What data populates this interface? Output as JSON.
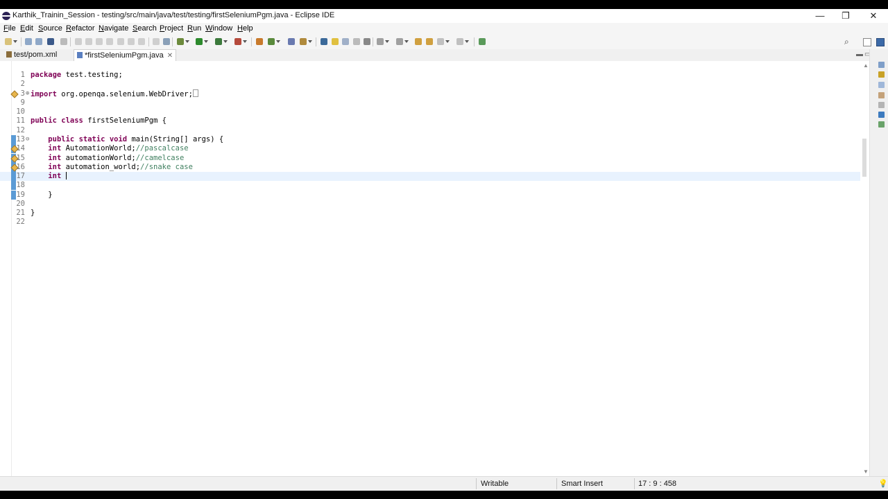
{
  "window": {
    "title": "Karthik_Trainin_Session - testing/src/main/java/test/testing/firstSeleniumPgm.java - Eclipse IDE",
    "controls": {
      "minimize": "—",
      "restore": "❐",
      "close": "✕"
    }
  },
  "menu": [
    "File",
    "Edit",
    "Source",
    "Refactor",
    "Navigate",
    "Search",
    "Project",
    "Run",
    "Window",
    "Help"
  ],
  "tabs": [
    {
      "label": "test/pom.xml",
      "active": false
    },
    {
      "label": "*firstSeleniumPgm.java",
      "active": true,
      "close": "✕"
    }
  ],
  "tab_controls": {
    "minimize": "▬",
    "maximize": "▭"
  },
  "editor": {
    "lines": [
      {
        "n": "1",
        "fold": "",
        "parts": [
          [
            "kw",
            "package"
          ],
          [
            "t",
            " test.testing;"
          ]
        ]
      },
      {
        "n": "2",
        "fold": "",
        "parts": []
      },
      {
        "n": "3",
        "fold": "⊕",
        "parts": [
          [
            "kw",
            "import"
          ],
          [
            "t",
            " org.openqa.selenium.WebDriver;"
          ],
          [
            "box",
            ""
          ]
        ],
        "marker": "warning"
      },
      {
        "n": "9",
        "fold": "",
        "parts": []
      },
      {
        "n": "10",
        "fold": "",
        "parts": []
      },
      {
        "n": "11",
        "fold": "",
        "parts": [
          [
            "kw",
            "public"
          ],
          [
            "t",
            " "
          ],
          [
            "kw",
            "class"
          ],
          [
            "t",
            " firstSeleniumPgm {"
          ]
        ]
      },
      {
        "n": "12",
        "fold": "",
        "parts": []
      },
      {
        "n": "13",
        "fold": "⊖",
        "parts": [
          [
            "t",
            "    "
          ],
          [
            "kw",
            "public"
          ],
          [
            "t",
            " "
          ],
          [
            "kw",
            "static"
          ],
          [
            "t",
            " "
          ],
          [
            "kw",
            "void"
          ],
          [
            "t",
            " main(String[] args) {"
          ]
        ],
        "marker": "bar"
      },
      {
        "n": "14",
        "fold": "",
        "parts": [
          [
            "t",
            "    "
          ],
          [
            "kw",
            "int"
          ],
          [
            "t",
            " AutomationWorld;"
          ],
          [
            "cm",
            "//pascalcase"
          ]
        ],
        "marker": "warnbar"
      },
      {
        "n": "15",
        "fold": "",
        "parts": [
          [
            "t",
            "    "
          ],
          [
            "kw",
            "int"
          ],
          [
            "t",
            " automationWorld;"
          ],
          [
            "cm",
            "//camelcase"
          ]
        ],
        "marker": "warnbar"
      },
      {
        "n": "16",
        "fold": "",
        "parts": [
          [
            "t",
            "    "
          ],
          [
            "kw",
            "int"
          ],
          [
            "t",
            " automation_world;"
          ],
          [
            "cm",
            "//snake case"
          ]
        ],
        "marker": "warnbar"
      },
      {
        "n": "17",
        "fold": "",
        "parts": [
          [
            "t",
            "    "
          ],
          [
            "kw",
            "int"
          ],
          [
            "t",
            " "
          ],
          [
            "caret",
            ""
          ]
        ],
        "marker": "bar",
        "current": true
      },
      {
        "n": "18",
        "fold": "",
        "parts": [],
        "marker": "bar"
      },
      {
        "n": "19",
        "fold": "",
        "parts": [
          [
            "t",
            "    }"
          ]
        ],
        "marker": "bar"
      },
      {
        "n": "20",
        "fold": "",
        "parts": []
      },
      {
        "n": "21",
        "fold": "",
        "parts": [
          [
            "t",
            "}"
          ]
        ]
      },
      {
        "n": "22",
        "fold": "",
        "parts": []
      }
    ]
  },
  "statusbar": {
    "mode": "Writable",
    "insert": "Smart Insert",
    "position": "17 : 9 : 458"
  },
  "colors": {
    "keyword": "#7f0055",
    "comment": "#3f7f5f",
    "current_line": "#e8f2fe",
    "marker_bar": "#5b9bd5"
  }
}
